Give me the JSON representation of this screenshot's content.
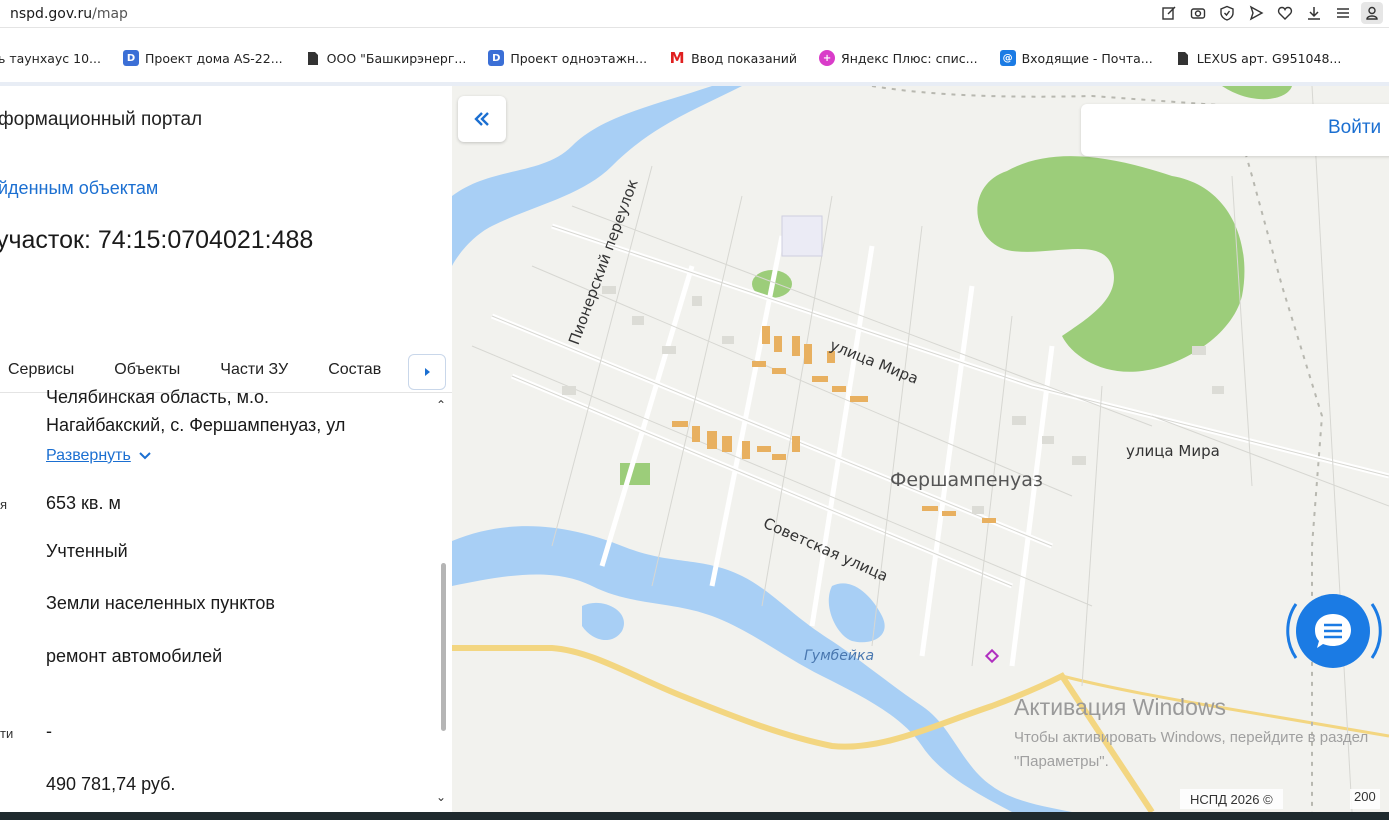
{
  "browser": {
    "url_domain": "nspd.gov.ru",
    "url_path": "/map",
    "toolbar_icons": [
      "edit-icon",
      "camera-icon",
      "shield-icon",
      "send-icon",
      "heart-icon",
      "download-icon",
      "menu-icon",
      "profile-icon"
    ]
  },
  "bookmarks": [
    {
      "label": "ь таунхаус 10...",
      "icon": "none"
    },
    {
      "label": "Проект дома AS-22...",
      "icon": "document-icon"
    },
    {
      "label": "ООО \"Башкирэнерг...",
      "icon": "file-icon"
    },
    {
      "label": "Проект одноэтажн...",
      "icon": "document-icon"
    },
    {
      "label": "Ввод показаний",
      "icon": "m-logo-icon"
    },
    {
      "label": "Яндекс Плюс: спис...",
      "icon": "yandex-plus-icon"
    },
    {
      "label": "Входящие - Почта...",
      "icon": "mail-icon"
    },
    {
      "label": "LEXUS арт. G951048...",
      "icon": "file-icon"
    }
  ],
  "panel": {
    "portal_title": "формационный портал",
    "found_link": "йденным объектам",
    "plot_title": "участок: 74:15:0704021:488",
    "tabs": [
      "Сервисы",
      "Объекты",
      "Части ЗУ",
      "Состав"
    ],
    "address_line1": "Челябинская область, м.о.",
    "address_line2": "Нагайбакский, с. Фершампенуаз, ул",
    "expand_label": "Развернуть",
    "area_label_fragment": "я",
    "area": "653 кв. м",
    "status": "Учтенный",
    "category": "Земли населенных пунктов",
    "usage": "ремонт автомобилей",
    "rights_label_fragment": "ти",
    "rights_value": "-",
    "cadastral_value": "490 781,74 руб."
  },
  "map": {
    "login_label": "Войти",
    "street_pioner": "Пионерский переулок",
    "street_mira_1": "улица Мира",
    "street_mira_2": "улица Мира",
    "street_sovetskaya": "Советская улица",
    "town": "Фершампенуаз",
    "river": "Гумбейка",
    "copyright": "НСПД 2026 ©",
    "scale": "200"
  },
  "os_overlay": {
    "activation_title": "Активация Windows",
    "activation_text": "Чтобы активировать Windows, перейдите в раздел \"Параметры\"."
  },
  "colors": {
    "accent": "#1b6fd1",
    "water": "#a8cff5",
    "forest": "#9ccd7a",
    "highway": "#f3d681",
    "parcels": "#e8b060"
  }
}
